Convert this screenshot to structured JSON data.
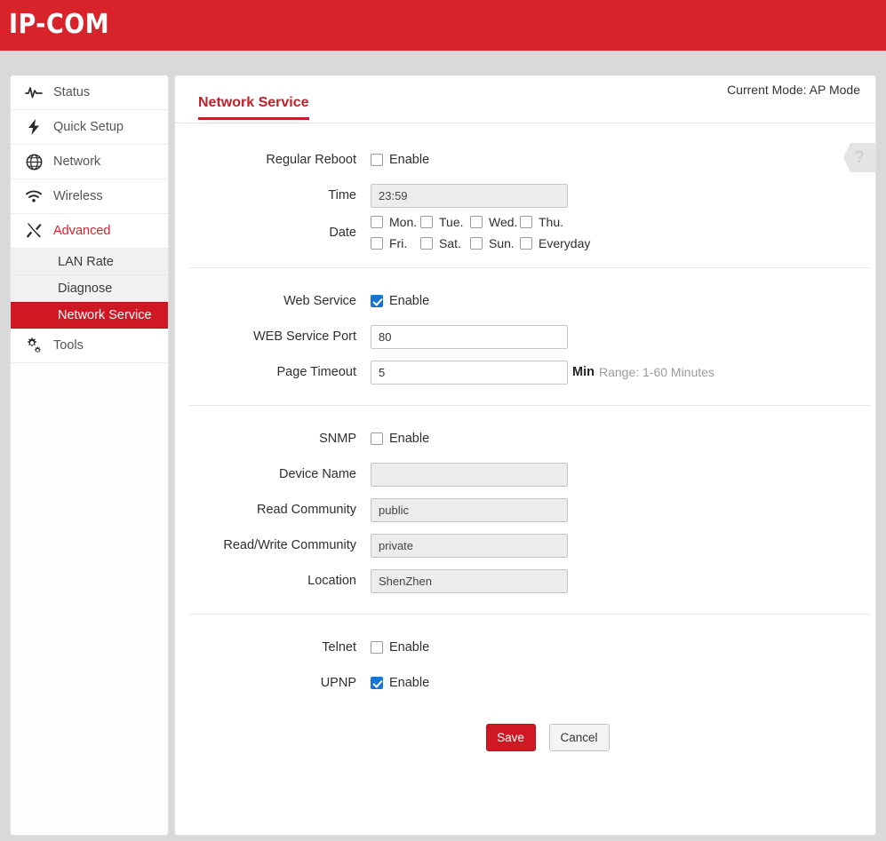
{
  "brand": {
    "name": "IP-COM",
    "color": "#d8232a"
  },
  "sidebar": {
    "items": [
      {
        "label": "Status",
        "icon": "activity-pulse-icon"
      },
      {
        "label": "Quick Setup",
        "icon": "lightning-bolt-icon"
      },
      {
        "label": "Network",
        "icon": "globe-icon"
      },
      {
        "label": "Wireless",
        "icon": "wifi-icon"
      },
      {
        "label": "Advanced",
        "icon": "tools-cross-icon"
      },
      {
        "label": "Tools",
        "icon": "gears-icon"
      }
    ],
    "subitems": [
      {
        "label": "LAN Rate"
      },
      {
        "label": "Diagnose"
      },
      {
        "label": "Network Service"
      }
    ],
    "active_parent": "Advanced",
    "active_sub": "Network Service"
  },
  "panel": {
    "title": "Network Service",
    "mode_text": "Current Mode: AP Mode",
    "help_glyph": "?"
  },
  "form": {
    "regular_reboot": {
      "label": "Regular Reboot",
      "enable_label": "Enable",
      "enabled": false,
      "time_label": "Time",
      "time_value": "23:59",
      "date_label": "Date",
      "days": [
        {
          "label": "Mon.",
          "checked": false
        },
        {
          "label": "Tue.",
          "checked": false
        },
        {
          "label": "Wed.",
          "checked": false
        },
        {
          "label": "Thu.",
          "checked": false
        },
        {
          "label": "Fri.",
          "checked": false
        },
        {
          "label": "Sat.",
          "checked": false
        },
        {
          "label": "Sun.",
          "checked": false
        },
        {
          "label": "Everyday",
          "checked": false
        }
      ]
    },
    "web_service": {
      "label": "Web Service",
      "enable_label": "Enable",
      "enabled": true,
      "port_label": "WEB Service Port",
      "port_value": "80",
      "timeout_label": "Page Timeout",
      "timeout_value": "5",
      "timeout_unit": "Min",
      "timeout_hint": "Range: 1-60 Minutes"
    },
    "snmp": {
      "label": "SNMP",
      "enable_label": "Enable",
      "enabled": false,
      "device_name_label": "Device Name",
      "device_name_value": "",
      "read_community_label": "Read Community",
      "read_community_value": "public",
      "rw_community_label": "Read/Write Community",
      "rw_community_value": "private",
      "location_label": "Location",
      "location_value": "ShenZhen"
    },
    "telnet": {
      "label": "Telnet",
      "enable_label": "Enable",
      "enabled": false
    },
    "upnp": {
      "label": "UPNP",
      "enable_label": "Enable",
      "enabled": true
    },
    "buttons": {
      "save": "Save",
      "cancel": "Cancel"
    }
  }
}
